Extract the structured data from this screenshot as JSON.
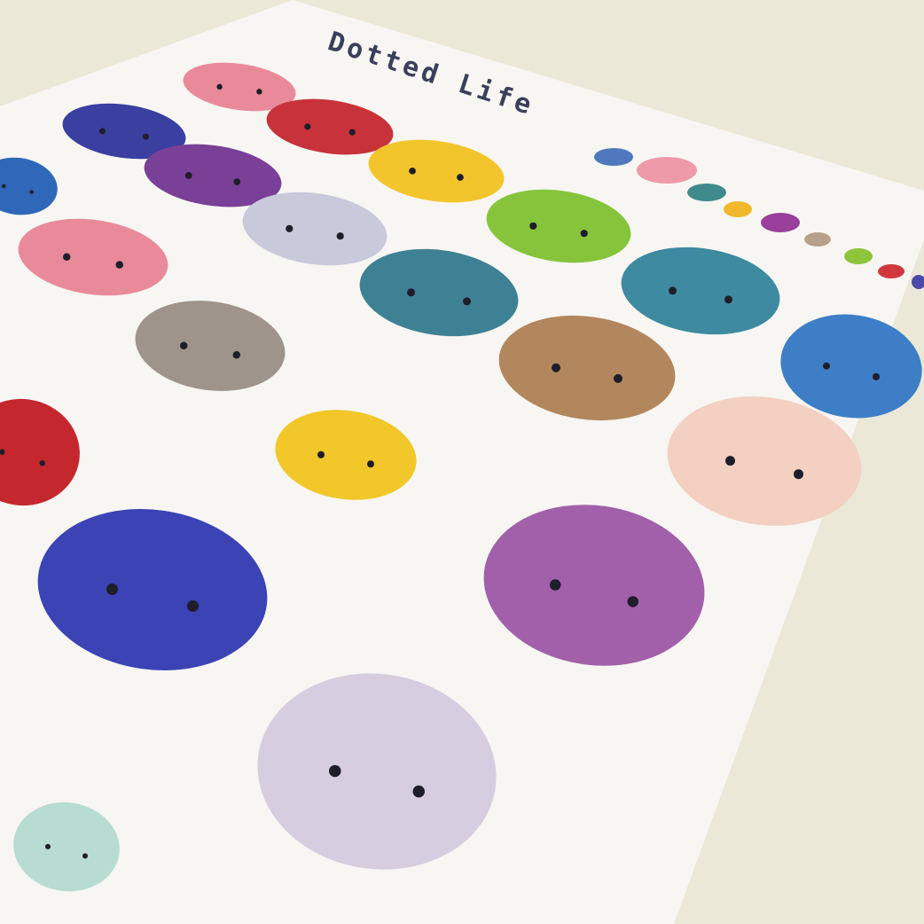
{
  "sheet": {
    "title": "Dotted Life",
    "background_color": "#ece8d8",
    "sheet_color": "#f7f6f2"
  },
  "stickers": [
    {
      "color": "#e98a9b"
    },
    {
      "color": "#3a3fa0"
    },
    {
      "color": "#c8323a"
    },
    {
      "color": "#2f68b8"
    },
    {
      "color": "#7a3f97"
    },
    {
      "color": "#f3c52c"
    },
    {
      "color": "#e98a9a"
    },
    {
      "color": "#c9c9dc"
    },
    {
      "color": "#86c43c"
    },
    {
      "color": "#9e948c"
    },
    {
      "color": "#3f8194"
    },
    {
      "color": "#3e8aa0"
    },
    {
      "color": "#b3875d"
    },
    {
      "color": "#3e7ec6"
    },
    {
      "color": "#c4282e"
    },
    {
      "color": "#f1c72a"
    },
    {
      "color": "#f3d0c2"
    },
    {
      "color": "#3b43b5"
    },
    {
      "color": "#a160a9"
    },
    {
      "color": "#d6cde0"
    },
    {
      "color": "#b8dcd2"
    }
  ],
  "mini_dots": [
    "#4f78be",
    "#ee9aa8",
    "#3f8a8c",
    "#f1b82c",
    "#9a3f9c",
    "#b8a08a",
    "#8cc43c",
    "#d0383e",
    "#4a4aa8"
  ]
}
